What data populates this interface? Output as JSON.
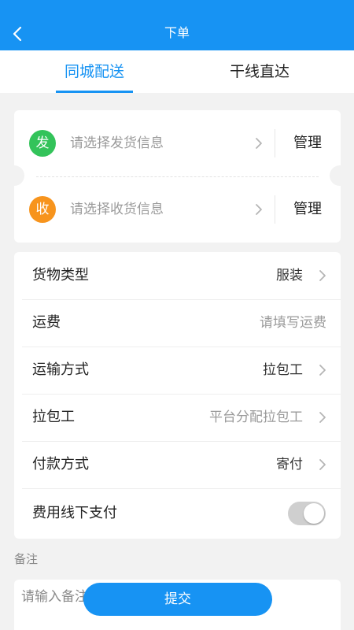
{
  "header": {
    "title": "下单",
    "back_icon": "chevron-left-icon"
  },
  "tabs": [
    {
      "label": "同城配送",
      "active": true
    },
    {
      "label": "干线直达",
      "active": false
    }
  ],
  "address": {
    "sender": {
      "badge": "发",
      "placeholder": "请选择发货信息",
      "manage_label": "管理",
      "badge_color": "#33c35a"
    },
    "receiver": {
      "badge": "收",
      "placeholder": "请选择收货信息",
      "manage_label": "管理",
      "badge_color": "#f7941d"
    }
  },
  "form": {
    "rows": [
      {
        "label": "货物类型",
        "value": "服装"
      },
      {
        "label": "运费",
        "placeholder": "请填写运费"
      },
      {
        "label": "运输方式",
        "value": "拉包工"
      },
      {
        "label": "拉包工",
        "placeholder": "平台分配拉包工"
      },
      {
        "label": "付款方式",
        "value": "寄付"
      },
      {
        "label": "费用线下支付",
        "toggle_on": false
      }
    ]
  },
  "remark": {
    "label": "备注",
    "placeholder": "请输入备注"
  },
  "submit_label": "提交",
  "colors": {
    "accent": "#1793f3",
    "send_badge": "#33c35a",
    "receive_badge": "#f7941d",
    "background": "#f2f2f2"
  }
}
